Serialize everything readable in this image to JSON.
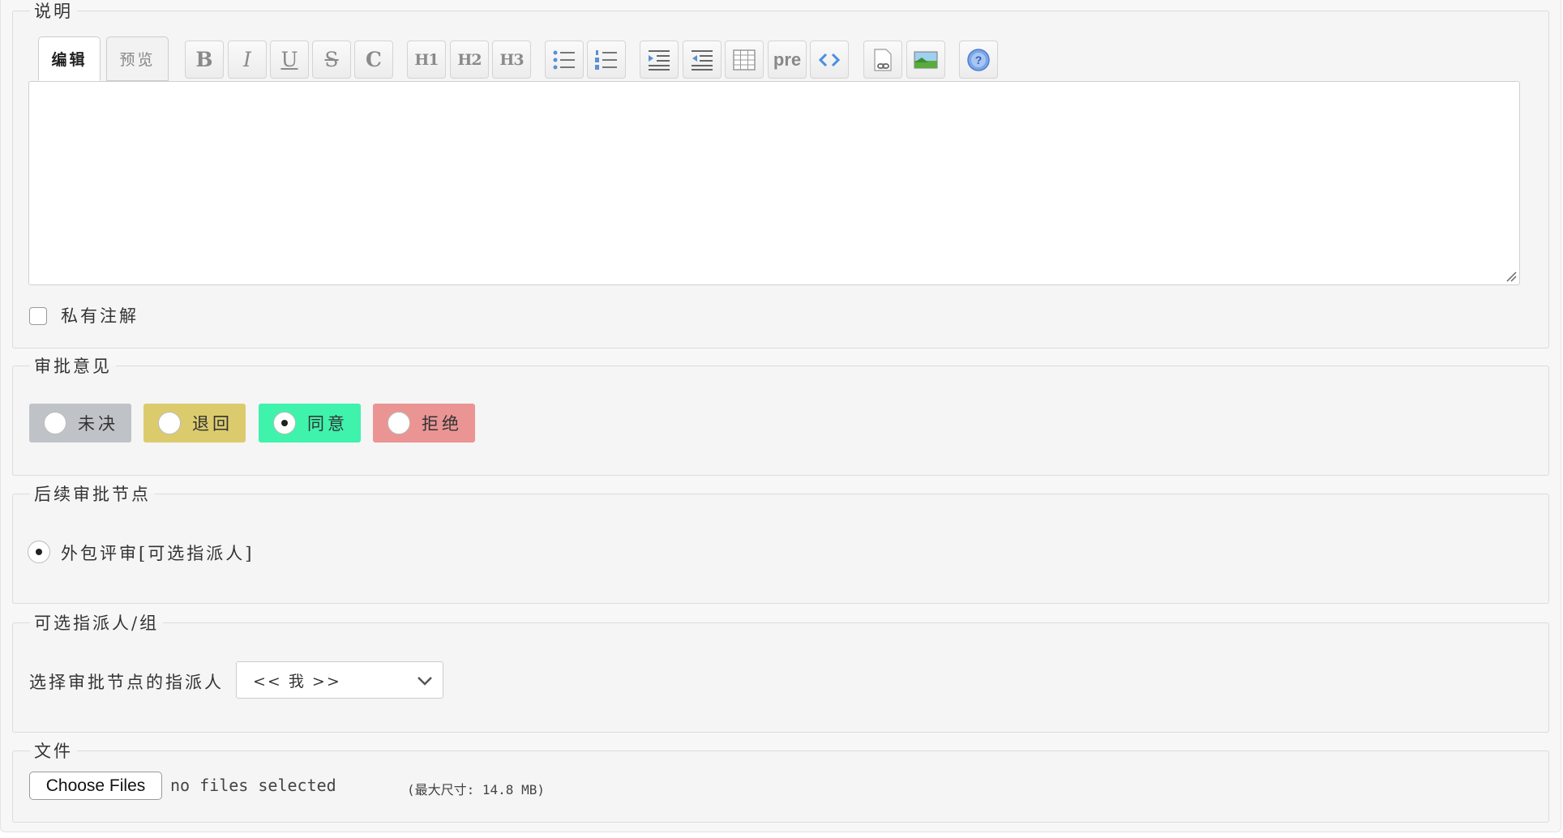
{
  "description": {
    "legend": "说明",
    "tabs": {
      "edit": "编辑",
      "preview": "预览"
    },
    "toolbar": {
      "bold": "B",
      "italic": "I",
      "underline": "U",
      "strike": "S",
      "code_c": "C",
      "h1": "H1",
      "h2": "H2",
      "h3": "H3",
      "pre": "pre"
    },
    "editor_value": "",
    "private_note_label": "私有注解",
    "private_note_checked": false
  },
  "approval": {
    "legend": "审批意见",
    "options": [
      {
        "label": "未决",
        "color": "#bfc3c7",
        "selected": false
      },
      {
        "label": "退回",
        "color": "#dccb6d",
        "selected": false
      },
      {
        "label": "同意",
        "color": "#3ff3ad",
        "selected": true
      },
      {
        "label": "拒绝",
        "color": "#ea9594",
        "selected": false
      }
    ]
  },
  "next_node": {
    "legend": "后续审批节点",
    "option_label": "外包评审[可选指派人]",
    "selected": true
  },
  "assignee": {
    "legend": "可选指派人/组",
    "label": "选择审批节点的指派人",
    "selected_value": "<< 我 >>"
  },
  "files": {
    "legend": "文件",
    "button_label": "Choose Files",
    "status": "no files selected",
    "max_size": "(最大尺寸: 14.8 MB)"
  }
}
